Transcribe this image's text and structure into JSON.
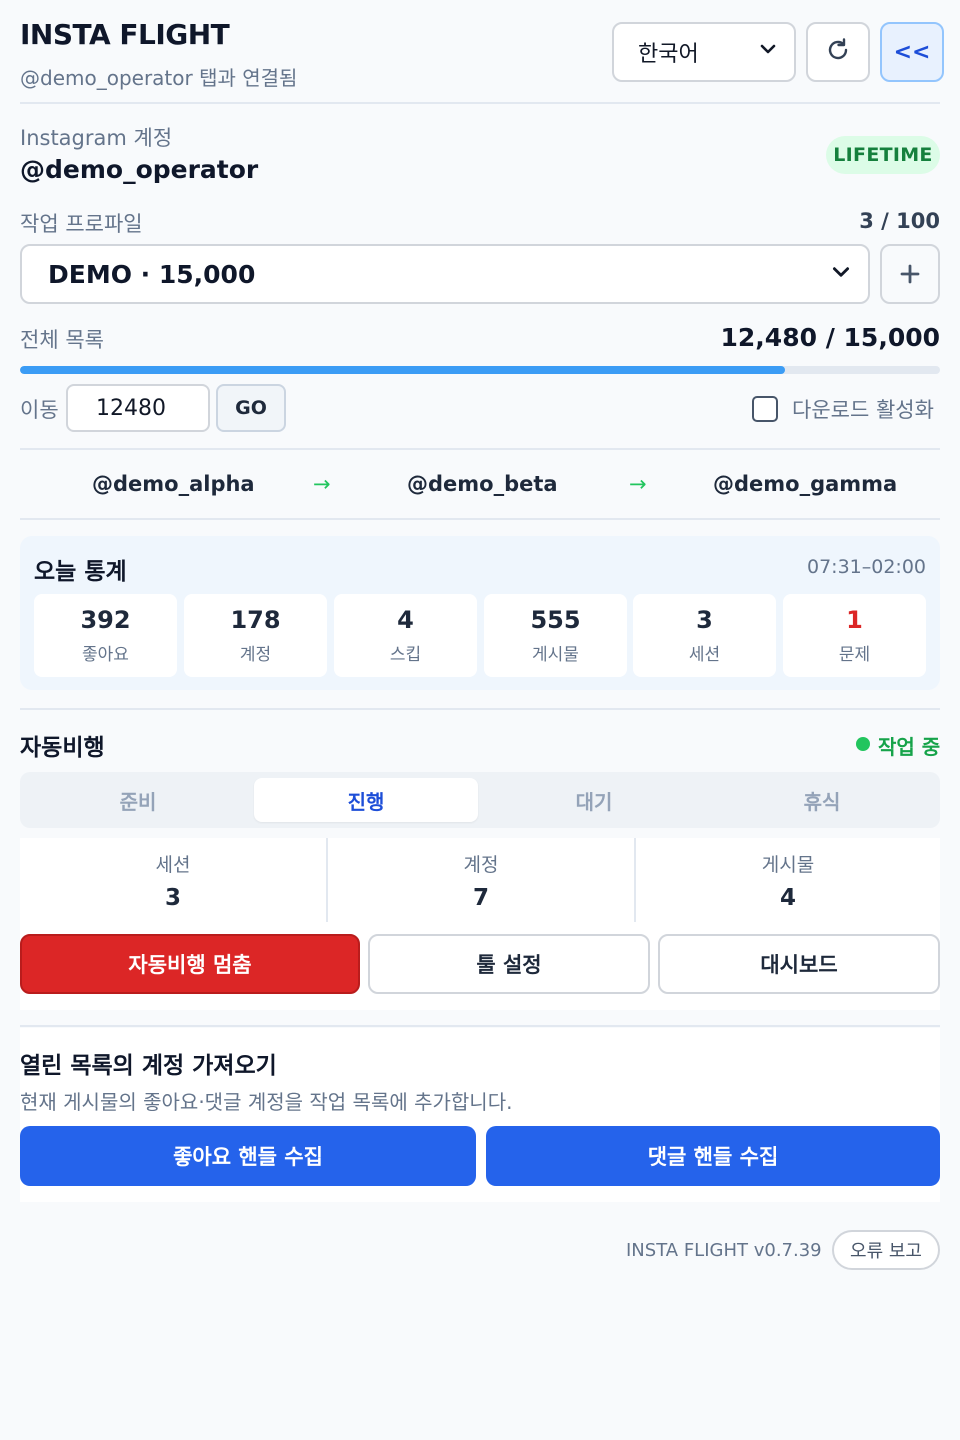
{
  "header": {
    "title": "INSTA FLIGHT",
    "subtitle": "@demo_operator 탭과 연결됨",
    "language": "한국어",
    "collapse_label": "<<"
  },
  "account": {
    "label": "Instagram 계정",
    "username": "@demo_operator",
    "badge": "LIFETIME"
  },
  "profile": {
    "label": "작업 프로파일",
    "count": "3 / 100",
    "selected": "DEMO · 15,000",
    "add_label": "+"
  },
  "list": {
    "label": "전체 목록",
    "count": "12,480 / 15,000",
    "progress": 0.832
  },
  "move": {
    "label": "이동",
    "value": "12480",
    "go_label": "GO",
    "download_label": "다운로드 활성화",
    "download_checked": false
  },
  "chain": {
    "items": [
      "@demo_alpha",
      "@demo_beta",
      "@demo_gamma"
    ],
    "arrow": "→"
  },
  "stats": {
    "title": "오늘 통계",
    "time_range": "07:31–02:00",
    "cards": [
      {
        "value": "392",
        "label": "좋아요"
      },
      {
        "value": "178",
        "label": "계정"
      },
      {
        "value": "4",
        "label": "스킵"
      },
      {
        "value": "555",
        "label": "게시물"
      },
      {
        "value": "3",
        "label": "세션"
      },
      {
        "value": "1",
        "label": "문제"
      }
    ]
  },
  "autopilot": {
    "title": "자동비행",
    "status": "작업 중",
    "tabs": [
      "준비",
      "진행",
      "대기",
      "휴식"
    ],
    "active_tab": "진행",
    "metrics": [
      {
        "label": "세션",
        "value": "3"
      },
      {
        "label": "계정",
        "value": "7"
      },
      {
        "label": "게시물",
        "value": "4"
      }
    ],
    "stop_label": "자동비행 멈춤",
    "tool_label": "툴 설정",
    "dashboard_label": "대시보드"
  },
  "import": {
    "title": "열린 목록의 계정 가져오기",
    "desc": "현재 게시물의 좋아요·댓글 계정을 작업 목록에 추가합니다.",
    "likes_label": "좋아요 핸들 수집",
    "comments_label": "댓글 핸들 수집"
  },
  "footer": {
    "version": "INSTA FLIGHT v0.7.39",
    "report_label": "오류 보고"
  },
  "colors": {
    "primary": "#2563eb",
    "danger": "#dc2626",
    "success": "#16a34a",
    "progress": "#3b9cf5"
  }
}
